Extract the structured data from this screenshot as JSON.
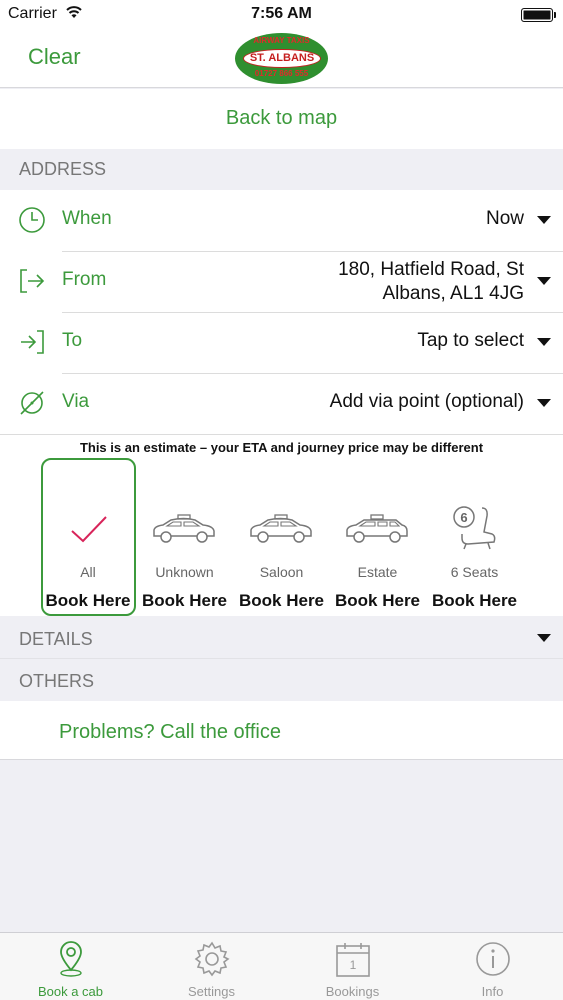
{
  "status_bar": {
    "carrier": "Carrier",
    "time": "7:56 AM"
  },
  "nav": {
    "left_button": "Clear",
    "logo": {
      "top": "AIRWAY TAXIS",
      "main": "ST. ALBANS",
      "bottom": "01727 866 555"
    }
  },
  "back_to_map": "Back to map",
  "address_section": {
    "header": "ADDRESS",
    "rows": [
      {
        "label": "When",
        "value": "Now",
        "icon": "clock-icon"
      },
      {
        "label": "From",
        "value_line1": "180, Hatfield Road, St",
        "value_line2": "Albans, AL1 4JG",
        "icon": "exit-arrow-icon"
      },
      {
        "label": "To",
        "value": "Tap to select",
        "icon": "enter-arrow-icon"
      },
      {
        "label": "Via",
        "value": "Add via point (optional)",
        "icon": "via-point-icon"
      }
    ]
  },
  "estimate_notice": "This is an estimate – your ETA and journey price may be different",
  "vehicles": [
    {
      "name": "All",
      "book": "Book Here",
      "icon": "checkmark-icon",
      "selected": true
    },
    {
      "name": "Unknown",
      "book": "Book Here",
      "icon": "taxi-car-icon"
    },
    {
      "name": "Saloon",
      "book": "Book Here",
      "icon": "saloon-car-icon"
    },
    {
      "name": "Estate",
      "book": "Book Here",
      "icon": "estate-car-icon"
    },
    {
      "name": "6 Seats",
      "book": "Book Here",
      "icon": "six-seats-icon",
      "badge": "6"
    }
  ],
  "details_header": "DETAILS",
  "others_header": "OTHERS",
  "problems_link": "Problems? Call the office",
  "tabs": [
    {
      "label": "Book a cab",
      "icon": "location-pin-icon",
      "active": true
    },
    {
      "label": "Settings",
      "icon": "gear-icon"
    },
    {
      "label": "Bookings",
      "icon": "calendar-icon",
      "badge": "1"
    },
    {
      "label": "Info",
      "icon": "info-icon"
    }
  ],
  "colors": {
    "accent": "#3c9a3c",
    "check": "#d8245a",
    "background": "#efeff4"
  }
}
